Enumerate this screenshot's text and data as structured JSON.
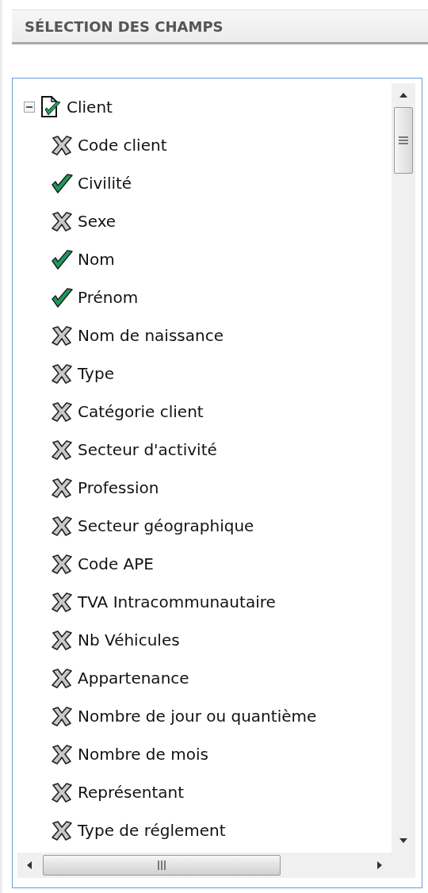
{
  "panel_title": "SÉLECTION DES CHAMPS",
  "tree": [
    {
      "label": "Client",
      "expanded": true,
      "checked": true,
      "children": [
        {
          "label": "Code client",
          "checked": false
        },
        {
          "label": "Civilité",
          "checked": true
        },
        {
          "label": "Sexe",
          "checked": false
        },
        {
          "label": "Nom",
          "checked": true
        },
        {
          "label": "Prénom",
          "checked": true
        },
        {
          "label": "Nom de naissance",
          "checked": false
        },
        {
          "label": "Type",
          "checked": false
        },
        {
          "label": "Catégorie client",
          "checked": false
        },
        {
          "label": "Secteur d'activité",
          "checked": false
        },
        {
          "label": "Profession",
          "checked": false
        },
        {
          "label": "Secteur géographique",
          "checked": false
        },
        {
          "label": "Code APE",
          "checked": false
        },
        {
          "label": "TVA Intracommunautaire",
          "checked": false
        },
        {
          "label": "Nb Véhicules",
          "checked": false
        },
        {
          "label": "Appartenance",
          "checked": false
        },
        {
          "label": "Nombre de jour ou quantième",
          "checked": false
        },
        {
          "label": "Nombre de mois",
          "checked": false
        },
        {
          "label": "Représentant",
          "checked": false
        },
        {
          "label": "Type de réglement",
          "checked": false
        }
      ]
    }
  ]
}
